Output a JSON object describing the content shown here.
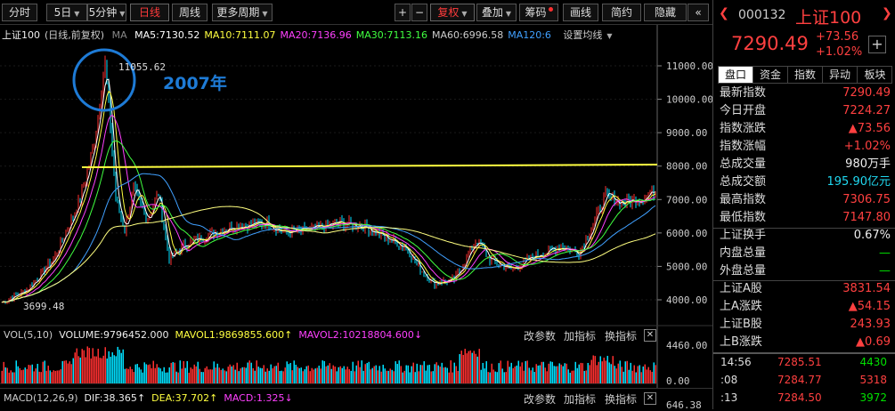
{
  "toolbar": {
    "buttons": [
      {
        "label": "分时",
        "active": false
      },
      {
        "label": "5日",
        "dropdown": true
      },
      {
        "label": "5分钟",
        "dropdown": true
      },
      {
        "label": "日线",
        "active": true
      },
      {
        "label": "周线"
      },
      {
        "label": "更多周期",
        "dropdown": true
      }
    ],
    "right_buttons": [
      {
        "label": "+"
      },
      {
        "label": "−"
      },
      {
        "label": "复权",
        "dropdown": true,
        "active": true
      },
      {
        "label": "叠加",
        "dropdown": true
      },
      {
        "label": "筹码",
        "dot": true
      },
      {
        "label": "画线"
      },
      {
        "label": "简约"
      },
      {
        "label": "隐藏"
      },
      {
        "label": "«"
      }
    ]
  },
  "main_chart": {
    "name": "上证100",
    "mode": "(日线,前复权)",
    "ma_label": "MA",
    "ma": [
      {
        "label": "MA5:7130.52",
        "color": "#ffffff"
      },
      {
        "label": "MA10:7111.07",
        "color": "#ffff40"
      },
      {
        "label": "MA20:7136.96",
        "color": "#ff40ff"
      },
      {
        "label": "MA30:7113.16",
        "color": "#40ff40"
      },
      {
        "label": "MA60:6996.58",
        "color": "#cccccc"
      },
      {
        "label": "MA120:6",
        "color": "#40a0ff"
      }
    ],
    "settings_label": "设置均线",
    "annotation": "2007年",
    "high_label": "11055.62",
    "low_label": "3699.48",
    "y_ticks": [
      "11000.00",
      "10000.00",
      "9000.00",
      "8000.00",
      "7000.00",
      "6000.00",
      "5000.00",
      "4000.00"
    ]
  },
  "volume_panel": {
    "label": "VOL(5,10)",
    "volume": "VOLUME:9796452.000",
    "mavol1": "MAVOL1:9869855.600",
    "mavol2": "MAVOL2:10218804.600",
    "buttons": [
      "改参数",
      "加指标",
      "换指标"
    ],
    "y_ticks": [
      "4460.00",
      "0.00"
    ]
  },
  "macd_panel": {
    "label": "MACD(12,26,9)",
    "dif": "DIF:38.365",
    "dea": "DEA:37.702",
    "macd": "MACD:1.325",
    "buttons": [
      "改参数",
      "加指标",
      "换指标"
    ],
    "y_tick": "646.38"
  },
  "quote": {
    "code": "000132",
    "name": "上证100",
    "price": "7290.49",
    "change": "+73.56",
    "change_pct": "+1.02%",
    "tabs": [
      "盘口",
      "资金",
      "指数",
      "异动",
      "板块"
    ],
    "rows": [
      {
        "label": "最新指数",
        "value": "7290.49",
        "color": "red"
      },
      {
        "label": "今日开盘",
        "value": "7224.27",
        "color": "red"
      },
      {
        "label": "指数涨跌",
        "value": "▲73.56",
        "color": "red"
      },
      {
        "label": "指数涨幅",
        "value": "+1.02%",
        "color": "red"
      },
      {
        "label": "总成交量",
        "value": "980万手",
        "color": "white"
      },
      {
        "label": "总成交额",
        "value": "195.90亿元",
        "color": "cyan"
      },
      {
        "label": "最高指数",
        "value": "7306.75",
        "color": "red"
      },
      {
        "label": "最低指数",
        "value": "7147.80",
        "color": "red"
      }
    ],
    "rows2": [
      {
        "label": "上证换手",
        "value": "0.67%",
        "color": "white"
      },
      {
        "label": "内盘总量",
        "value": "—",
        "color": "green"
      },
      {
        "label": "外盘总量",
        "value": "—",
        "color": "green"
      }
    ],
    "rows3": [
      {
        "label": "上证A股",
        "value": "3831.54",
        "color": "red"
      },
      {
        "label": "上A涨跌",
        "value": "▲54.15",
        "color": "red"
      },
      {
        "label": "上证B股",
        "value": "243.93",
        "color": "red"
      },
      {
        "label": "上B涨跌",
        "value": "▲0.69",
        "color": "red"
      }
    ],
    "ticks": [
      {
        "time": "14:56",
        "price": "7285.51",
        "vol": "4430"
      },
      {
        "time": ":08",
        "price": "7284.77",
        "vol": "5318"
      },
      {
        "time": ":13",
        "price": "7284.50",
        "vol": "3972"
      }
    ]
  },
  "colors": {
    "up": "#ff3030",
    "down": "#00e0ff",
    "resistance": "#ffff40",
    "annotation": "#1e7bd6"
  }
}
